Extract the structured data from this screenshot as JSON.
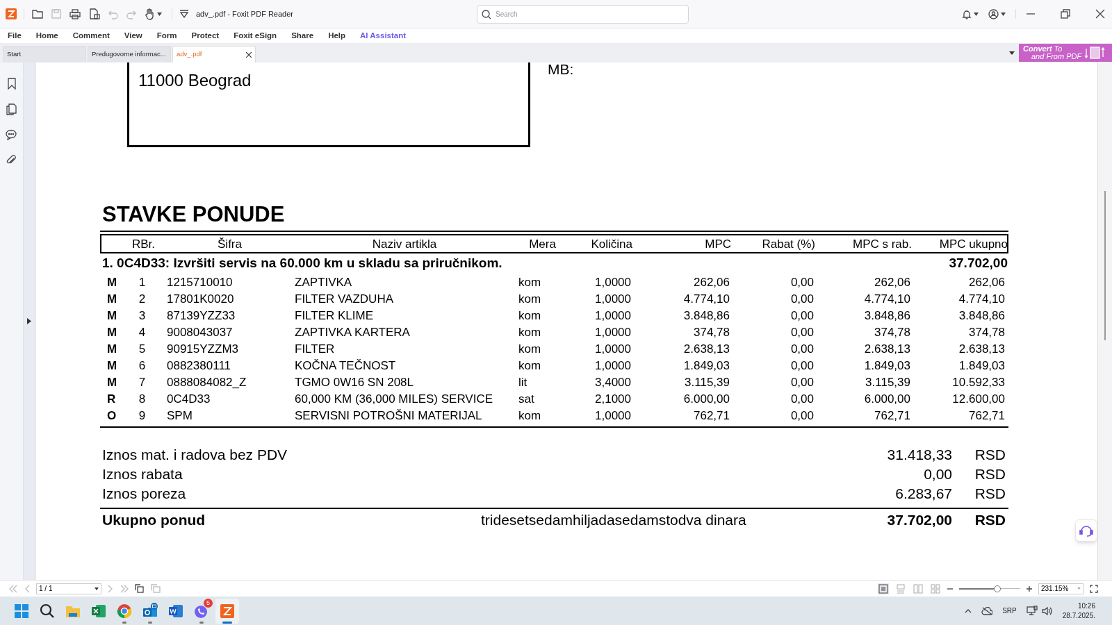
{
  "title_bar": {
    "title": "adv_.pdf - Foxit PDF Reader",
    "search_placeholder": "Search"
  },
  "menu": [
    {
      "label": "File",
      "kind": "plain"
    },
    {
      "label": "Home",
      "kind": "plain"
    },
    {
      "label": "Comment",
      "kind": "plain"
    },
    {
      "label": "View",
      "kind": "plain"
    },
    {
      "label": "Form",
      "kind": "plain"
    },
    {
      "label": "Protect",
      "kind": "plain"
    },
    {
      "label": "Foxit eSign",
      "kind": "plain"
    },
    {
      "label": "Share",
      "kind": "plain"
    },
    {
      "label": "Help",
      "kind": "plain"
    },
    {
      "label": "AI Assistant",
      "kind": "ai"
    }
  ],
  "tabs": [
    {
      "label": "Start",
      "selected": false
    },
    {
      "label": "Predugovorne informac...",
      "selected": false
    },
    {
      "label": "adv_.pdf",
      "selected": true
    }
  ],
  "convert_banner": {
    "line1": "**Convert** To",
    "line2": "and From PDF"
  },
  "document": {
    "address": "11000 Beograd",
    "mb_label": "MB:",
    "section_title": "STAVKE PONUDE",
    "columns": [
      "",
      "RBr.",
      "Šifra",
      "Naziv artikla",
      "Mera",
      "Količina",
      "MPC",
      "Rabat (%)",
      "MPC s rab.",
      "MPC ukupno"
    ],
    "group": {
      "title": "1. 0C4D33: Izvršiti servis na 60.000 km u skladu sa priručnikom.",
      "total": "37.702,00"
    },
    "rows": [
      [
        "M",
        "1",
        "1215710010",
        "ZAPTIVKA",
        "kom",
        "1,0000",
        "262,06",
        "0,00",
        "262,06",
        "262,06"
      ],
      [
        "M",
        "2",
        "17801K0020",
        "FILTER VAZDUHA",
        "kom",
        "1,0000",
        "4.774,10",
        "0,00",
        "4.774,10",
        "4.774,10"
      ],
      [
        "M",
        "3",
        "87139YZZ33",
        "FILTER KLIME",
        "kom",
        "1,0000",
        "3.848,86",
        "0,00",
        "3.848,86",
        "3.848,86"
      ],
      [
        "M",
        "4",
        "9008043037",
        "ZAPTIVKA KARTERA",
        "kom",
        "1,0000",
        "374,78",
        "0,00",
        "374,78",
        "374,78"
      ],
      [
        "M",
        "5",
        "90915YZZM3",
        "FILTER",
        "kom",
        "1,0000",
        "2.638,13",
        "0,00",
        "2.638,13",
        "2.638,13"
      ],
      [
        "M",
        "6",
        "0882380111",
        "KOČNA TEČNOST",
        "kom",
        "1,0000",
        "1.849,03",
        "0,00",
        "1.849,03",
        "1.849,03"
      ],
      [
        "M",
        "7",
        "0888084082_Z",
        "TGMO 0W16 SN 208L",
        "lit",
        "3,4000",
        "3.115,39",
        "0,00",
        "3.115,39",
        "10.592,33"
      ],
      [
        "R",
        "8",
        "0C4D33",
        "60,000 KM (36,000 MILES) SERVICE",
        "sat",
        "2,1000",
        "6.000,00",
        "0,00",
        "6.000,00",
        "12.600,00"
      ],
      [
        "O",
        "9",
        "SPM",
        "SERVISNI POTROŠNI MATERIJAL",
        "kom",
        "1,0000",
        "762,71",
        "0,00",
        "762,71",
        "762,71"
      ]
    ],
    "summary": [
      {
        "label": "Iznos mat. i radova bez PDV",
        "value": "31.418,33",
        "currency": "RSD"
      },
      {
        "label": "Iznos rabata",
        "value": "0,00",
        "currency": "RSD"
      },
      {
        "label": "Iznos poreza",
        "value": "6.283,67",
        "currency": "RSD"
      }
    ],
    "total": {
      "label": "Ukupno ponud",
      "words": "tridesetsedamhiljadasedamstodva dinara",
      "value": "37.702,00",
      "currency": "RSD"
    }
  },
  "bottom_bar": {
    "page": "1 / 1",
    "zoom": "231.15%",
    "zoom_slider": {
      "level": 0.63
    },
    "view_modes": [
      {
        "selected": true
      },
      {
        "selected": false
      },
      {
        "selected": false
      },
      {
        "selected": false
      }
    ]
  },
  "taskbar": {
    "apps": [
      {
        "kind": "start",
        "running": false,
        "active": false
      },
      {
        "kind": "search",
        "running": false,
        "active": false
      },
      {
        "kind": "folder",
        "running": false,
        "active": false
      },
      {
        "kind": "sheet",
        "running": false,
        "active": false
      },
      {
        "kind": "browser",
        "running": true,
        "active": false
      },
      {
        "kind": "mail",
        "running": true,
        "active": false
      },
      {
        "kind": "doc",
        "running": false,
        "active": false
      },
      {
        "kind": "phone",
        "running": true,
        "active": false,
        "badge": "5"
      },
      {
        "kind": "pdf",
        "running": true,
        "active": true
      }
    ],
    "language": "SRP",
    "time": "10:26",
    "date": "28.7.2025."
  }
}
